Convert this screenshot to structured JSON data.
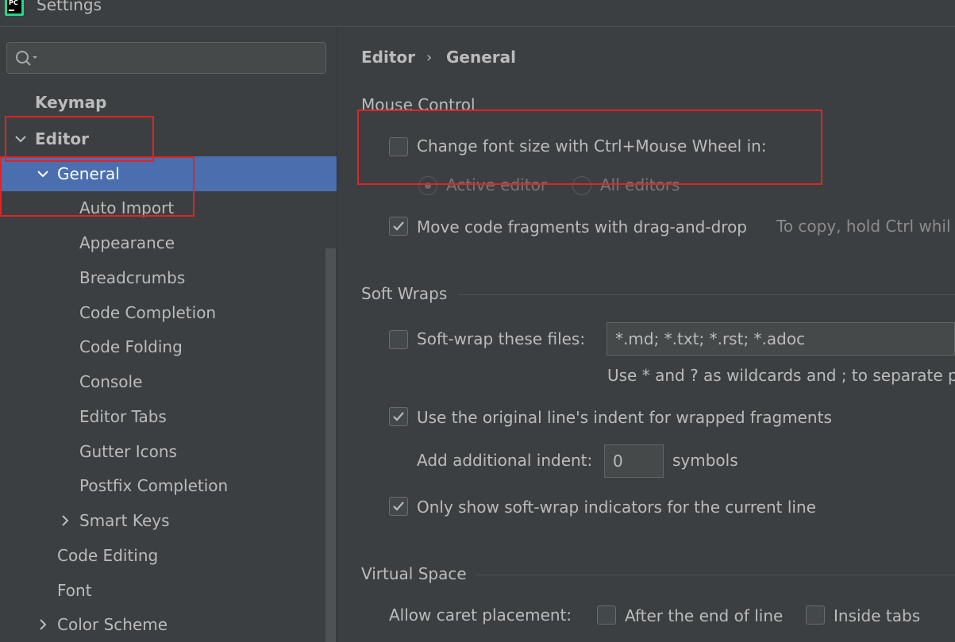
{
  "window": {
    "title": "Settings",
    "logo_text": "PC"
  },
  "search": {
    "placeholder": ""
  },
  "sidebar": {
    "items": [
      {
        "label": "Keymap"
      },
      {
        "label": "Editor"
      },
      {
        "label": "General"
      },
      {
        "label": "Auto Import"
      },
      {
        "label": "Appearance"
      },
      {
        "label": "Breadcrumbs"
      },
      {
        "label": "Code Completion"
      },
      {
        "label": "Code Folding"
      },
      {
        "label": "Console"
      },
      {
        "label": "Editor Tabs"
      },
      {
        "label": "Gutter Icons"
      },
      {
        "label": "Postfix Completion"
      },
      {
        "label": "Smart Keys"
      },
      {
        "label": "Code Editing"
      },
      {
        "label": "Font"
      },
      {
        "label": "Color Scheme"
      }
    ]
  },
  "breadcrumb": {
    "parent": "Editor",
    "separator": "›",
    "current": "General"
  },
  "mouse_control": {
    "title": "Mouse Control",
    "change_font_size": {
      "label": "Change font size with Ctrl+Mouse Wheel in:",
      "checked": false
    },
    "active_editor": {
      "label": "Active editor",
      "selected": true
    },
    "all_editors": {
      "label": "All editors",
      "selected": false
    },
    "drag_drop": {
      "label": "Move code fragments with drag-and-drop",
      "checked": true,
      "hint": "To copy, hold Ctrl whil"
    }
  },
  "soft_wraps": {
    "title": "Soft Wraps",
    "soft_wrap_files": {
      "label": "Soft-wrap these files:",
      "checked": false,
      "value": "*.md; *.txt; *.rst; *.adoc"
    },
    "wildcard_hint": "Use * and ? as wildcards and ; to separate p",
    "original_indent": {
      "label": "Use the original line's indent for wrapped fragments",
      "checked": true
    },
    "additional_indent": {
      "label": "Add additional indent:",
      "value": "0",
      "unit": "symbols"
    },
    "indicators": {
      "label": "Only show soft-wrap indicators for the current line",
      "checked": true
    }
  },
  "virtual_space": {
    "title": "Virtual Space",
    "caret_label": "Allow caret placement:",
    "after_end": {
      "label": "After the end of line",
      "checked": false
    },
    "inside_tabs": {
      "label": "Inside tabs",
      "checked": false
    }
  },
  "colors": {
    "selection": "#4b6eaf",
    "annotation": "#e02424",
    "background": "#3c3f41"
  }
}
